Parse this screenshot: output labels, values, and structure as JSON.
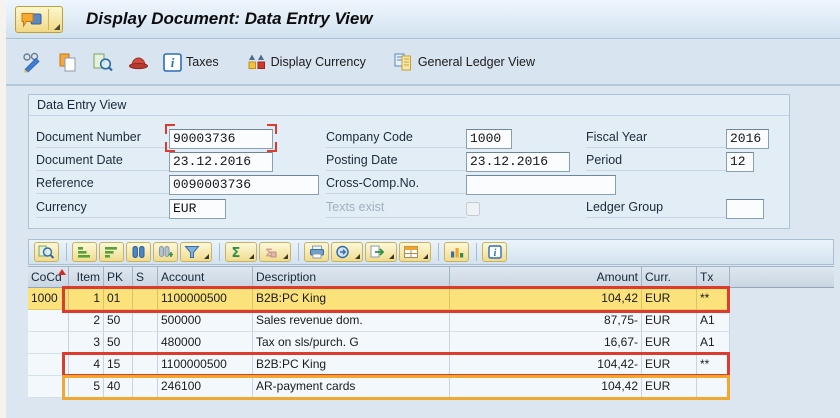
{
  "window": {
    "title": "Display Document: Data Entry View"
  },
  "app_toolbar": {
    "icons": [
      "display-change",
      "copy",
      "overview",
      "document-header",
      "info"
    ],
    "taxes_label": "Taxes",
    "display_currency_label": "Display Currency",
    "general_ledger_label": "General Ledger View"
  },
  "data_entry_view": {
    "title": "Data Entry View",
    "fields": {
      "document_number": {
        "label": "Document Number",
        "value": "90003736"
      },
      "document_date": {
        "label": "Document Date",
        "value": "23.12.2016"
      },
      "reference": {
        "label": "Reference",
        "value": "0090003736"
      },
      "currency": {
        "label": "Currency",
        "value": "EUR"
      },
      "company_code": {
        "label": "Company Code",
        "value": "1000"
      },
      "posting_date": {
        "label": "Posting Date",
        "value": "23.12.2016"
      },
      "cross_comp_no": {
        "label": "Cross-Comp.No.",
        "value": ""
      },
      "texts_exist": {
        "label": "Texts exist",
        "checked": false
      },
      "fiscal_year": {
        "label": "Fiscal Year",
        "value": "2016"
      },
      "period": {
        "label": "Period",
        "value": "12"
      },
      "ledger_group": {
        "label": "Ledger Group",
        "value": ""
      }
    }
  },
  "grid": {
    "toolbar_icons": [
      "detail",
      "sort-ascending",
      "sort-descending",
      "find",
      "find-next",
      "set-filter",
      "total",
      "subtotal",
      "print",
      "views",
      "export",
      "choose-layout",
      "graphic",
      "info"
    ],
    "sorted_column": "CoCd",
    "columns": {
      "cocd": "CoCd",
      "item": "Item",
      "pk": "PK",
      "s": "S",
      "account": "Account",
      "description": "Description",
      "amount": "Amount",
      "curr": "Curr.",
      "tx": "Tx"
    },
    "rows": [
      {
        "cocd": "1000",
        "item": "1",
        "pk": "01",
        "s": "",
        "account": "1100000500",
        "description": "B2B:PC King",
        "amount": "104,42",
        "curr": "EUR",
        "tx": "**"
      },
      {
        "cocd": "",
        "item": "2",
        "pk": "50",
        "s": "",
        "account": "500000",
        "description": "Sales revenue dom.",
        "amount": "87,75-",
        "curr": "EUR",
        "tx": "A1"
      },
      {
        "cocd": "",
        "item": "3",
        "pk": "50",
        "s": "",
        "account": "480000",
        "description": "Tax on sls/purch. G",
        "amount": "16,67-",
        "curr": "EUR",
        "tx": "A1"
      },
      {
        "cocd": "",
        "item": "4",
        "pk": "15",
        "s": "",
        "account": "1100000500",
        "description": "B2B:PC King",
        "amount": "104,42-",
        "curr": "EUR",
        "tx": "**"
      },
      {
        "cocd": "",
        "item": "5",
        "pk": "40",
        "s": "",
        "account": "246100",
        "description": "AR-payment cards",
        "amount": "104,42",
        "curr": "EUR",
        "tx": ""
      }
    ]
  },
  "annotations": {
    "red_boxes": [
      "document-number-field",
      "row-1",
      "row-4"
    ],
    "orange_boxes": [
      "row-5"
    ]
  },
  "colors": {
    "row_highlight": "#fbe27b",
    "annotation_red": "#dd3b2e",
    "annotation_orange": "#f2a72e",
    "page_bg": "#dbe6f0",
    "toolbar_bg": "#d8e5f1"
  }
}
